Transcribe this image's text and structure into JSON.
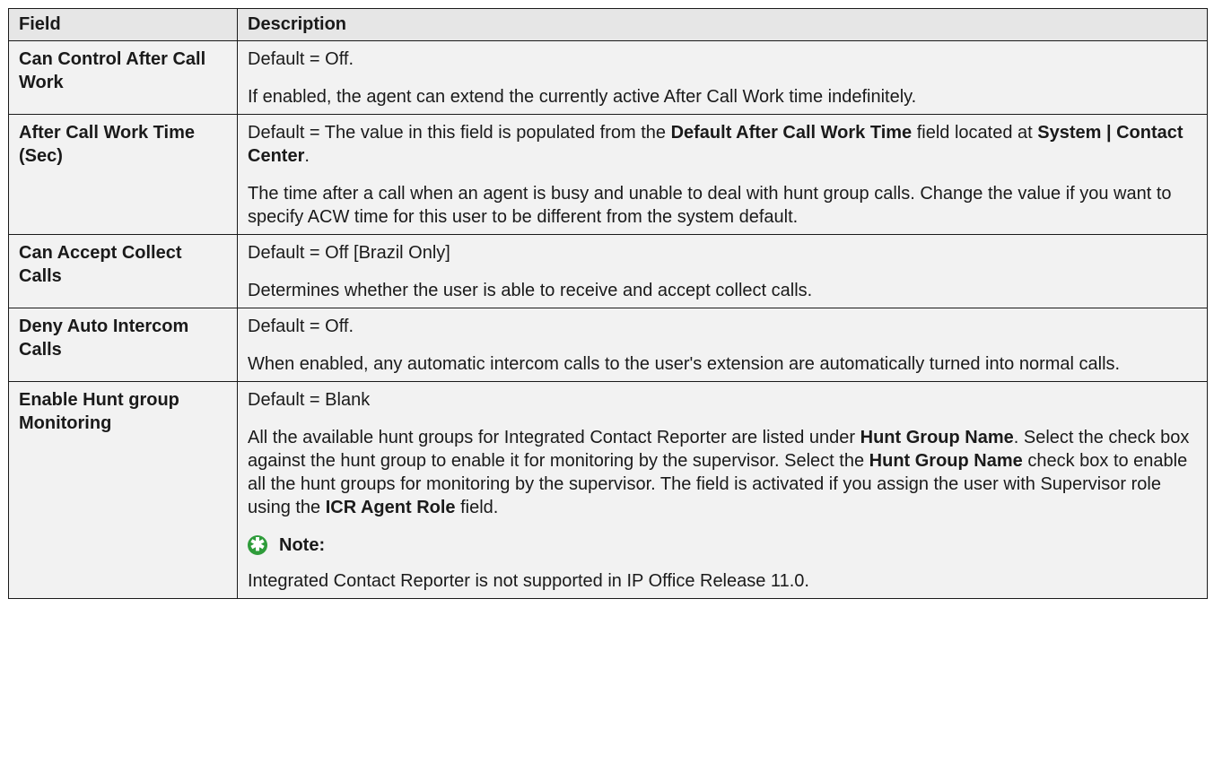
{
  "table": {
    "headers": [
      "Field",
      "Description"
    ],
    "rows": [
      {
        "field": "Can Control After Call Work",
        "p1": "Default = Off.",
        "p2": "If enabled, the agent can extend the currently active After Call Work time indefinitely."
      },
      {
        "field": "After Call Work Time (Sec)",
        "p1_a": "Default = The value in this field is populated from the ",
        "p1_b": "Default After Call Work Time",
        "p1_c": " field located at ",
        "p1_d": "System | Contact Center",
        "p1_e": ".",
        "p2": "The time after a call when an agent is busy and unable to deal with hunt group calls. Change the value if you want to specify ACW time for this user to be different from the system default."
      },
      {
        "field": "Can Accept Collect Calls",
        "p1": "Default = Off [Brazil Only]",
        "p2": "Determines whether the user is able to receive and accept collect calls."
      },
      {
        "field": "Deny Auto Intercom Calls",
        "p1": "Default = Off.",
        "p2": "When enabled, any automatic intercom calls to the user's extension are automatically turned into normal calls."
      },
      {
        "field": "Enable Hunt group Monitoring",
        "p1": "Default = Blank",
        "p2_a": "All the available hunt groups for Integrated Contact Reporter are listed under ",
        "p2_b": "Hunt Group Name",
        "p2_c": ". Select the check box against the hunt group to enable it for monitoring by the supervisor. Select the ",
        "p2_d": "Hunt Group Name",
        "p2_e": " check box to enable all the hunt groups for monitoring by the supervisor. The field is activated if you assign the user with Supervisor role using the ",
        "p2_f": "ICR Agent Role",
        "p2_g": " field.",
        "note_label": "Note:",
        "note_icon": "asterisk-icon",
        "note_text": "Integrated Contact Reporter is not supported in IP Office Release 11.0."
      }
    ]
  },
  "colors": {
    "header_bg": "#e6e6e6",
    "cell_bg": "#f2f2f2",
    "note_icon": "#2e9c3a"
  }
}
